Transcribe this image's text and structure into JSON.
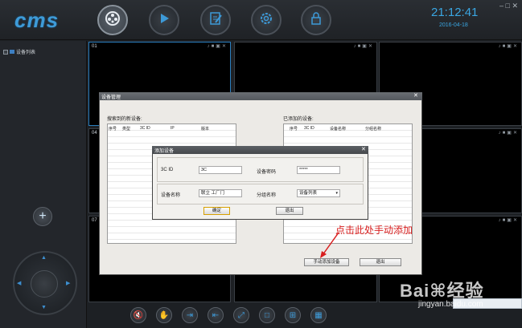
{
  "app": {
    "logo": "cms",
    "time": "21:12:41",
    "date": "2016-04-18",
    "window_controls": "– □ ✕"
  },
  "toolbar_top": [
    {
      "icon": "film-reel-icon",
      "active": true
    },
    {
      "icon": "play-icon",
      "active": false
    },
    {
      "icon": "edit-icon",
      "active": false
    },
    {
      "icon": "gear-icon",
      "active": false
    },
    {
      "icon": "lock-icon",
      "active": false
    }
  ],
  "sidebar": {
    "tree_item_label": "设备列表",
    "add_symbol": "+"
  },
  "video_grid": {
    "cells": [
      {
        "label": "01",
        "selected": true
      },
      {
        "label": "",
        "selected": false
      },
      {
        "label": "",
        "selected": false
      },
      {
        "label": "04",
        "selected": false
      },
      {
        "label": "",
        "selected": false
      },
      {
        "label": "",
        "selected": false
      },
      {
        "label": "07",
        "selected": false
      },
      {
        "label": "",
        "selected": false
      },
      {
        "label": "",
        "selected": false
      }
    ],
    "cell_icons": "♪■▣✕"
  },
  "toolbar_bottom": [
    {
      "icon": "mute-icon",
      "glyph": "🔇"
    },
    {
      "icon": "hand-icon",
      "glyph": "✋"
    },
    {
      "icon": "export-icon",
      "glyph": "⇥"
    },
    {
      "icon": "import-icon",
      "glyph": "⇤"
    },
    {
      "icon": "fullscreen-icon",
      "glyph": "⤢"
    },
    {
      "icon": "layout-1-icon",
      "glyph": "□"
    },
    {
      "icon": "layout-4-icon",
      "glyph": "⊞"
    },
    {
      "icon": "layout-9-icon",
      "glyph": "▦"
    }
  ],
  "device_manager": {
    "title": "设备管理",
    "close": "✕",
    "searched_label": "搜索到的新设备:",
    "added_label": "已添加的设备:",
    "left_columns": [
      "序号",
      "类型",
      "3C ID",
      "IP",
      "版本"
    ],
    "right_columns": [
      "序号",
      "3C ID",
      "设备名称",
      "分组名称"
    ],
    "manual_add_button": "手动添加设备",
    "exit_button": "退出"
  },
  "add_device": {
    "title": "添加设备",
    "close": "✕",
    "id_label": "3C ID",
    "id_value": "3C",
    "password_label": "设备密码",
    "password_value": "*****",
    "name_label": "设备名称",
    "name_value": "联立 工厂门",
    "group_label": "分组名称",
    "group_value": "设备列表",
    "ok_button": "确定",
    "cancel_button": "退出"
  },
  "annotation": "点击此处手动添加",
  "watermark": {
    "logo": "Bai⌘经验",
    "url": "jingyan.baidu.com"
  }
}
